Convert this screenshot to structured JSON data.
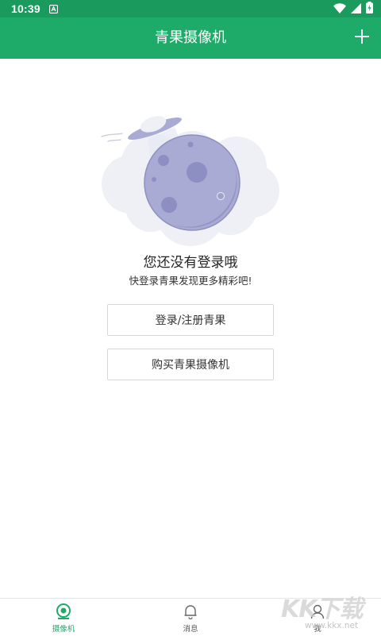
{
  "status_bar": {
    "time": "10:39"
  },
  "app_bar": {
    "title": "青果摄像机",
    "add_icon": "plus-icon"
  },
  "empty_state": {
    "illustration": "moon-ufo-cloud-illustration",
    "title": "您还没有登录哦",
    "subtitle": "快登录青果发现更多精彩吧!"
  },
  "actions": {
    "login_label": "登录/注册青果",
    "buy_label": "购买青果摄像机"
  },
  "bottom_nav": {
    "items": [
      {
        "label": "摄像机",
        "icon": "camera-icon",
        "active": true
      },
      {
        "label": "消息",
        "icon": "bell-icon",
        "active": false
      },
      {
        "label": "我",
        "icon": "person-icon",
        "active": false
      }
    ]
  },
  "watermark": {
    "text": "KK下载",
    "url": "www.kkx.net"
  },
  "colors": {
    "primary": "#1eaa68",
    "status_bar": "#1a9a5d",
    "moon": "#a9abd5",
    "cloud": "#eef0f6"
  }
}
